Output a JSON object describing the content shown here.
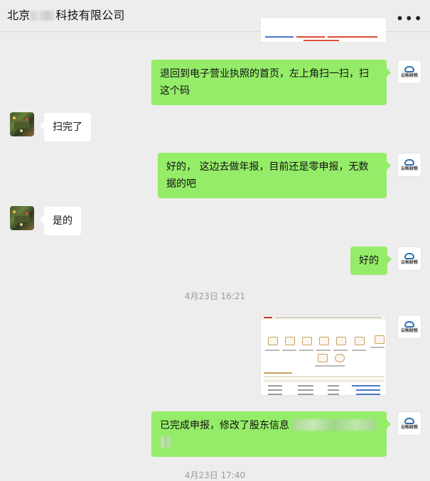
{
  "header": {
    "title_prefix": "北京",
    "title_suffix": "科技有限公司",
    "more_label": "•••"
  },
  "avatars": {
    "me_brand": "云帐财税"
  },
  "messages": [
    {
      "side": "out",
      "text": "退回到电子营业执照的首页，左上角扫一扫，扫这个码"
    },
    {
      "side": "in",
      "text": "扫完了"
    },
    {
      "side": "out",
      "text": "好的，  这边去做年报，目前还是零申报，无数据的吧"
    },
    {
      "side": "in",
      "text": "是的"
    },
    {
      "side": "out",
      "text": "好的"
    },
    {
      "side": "time",
      "text": "4月23日 16:21"
    },
    {
      "side": "out",
      "type": "image",
      "alt": "申报系统截图"
    },
    {
      "side": "out",
      "text_prefix": "已完成申报，修改了股东信息"
    },
    {
      "side": "time",
      "text": "4月23日 17:40"
    }
  ]
}
